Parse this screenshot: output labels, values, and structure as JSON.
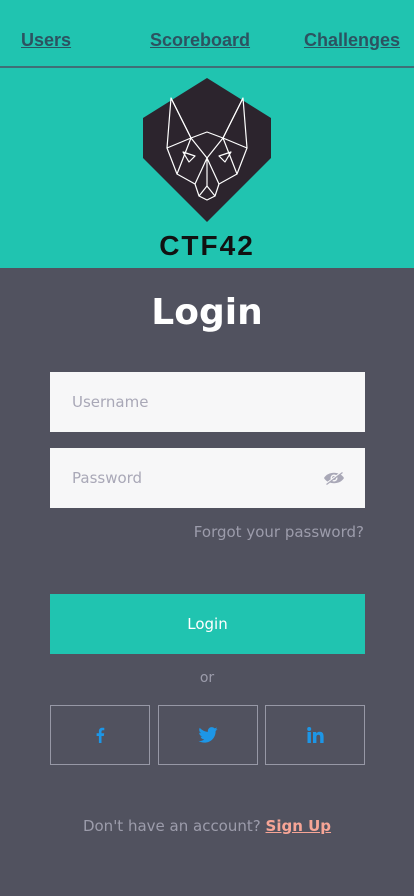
{
  "nav": {
    "users": "Users",
    "scoreboard": "Scoreboard",
    "challenges": "Challenges"
  },
  "brand": {
    "name": "CTF42",
    "logo_icon": "wolf-shield-icon"
  },
  "login": {
    "title": "Login",
    "username_placeholder": "Username",
    "password_placeholder": "Password",
    "password_toggle_icon": "eye-icon",
    "forgot_password": "Forgot your password?",
    "submit_label": "Login",
    "or_label": "or"
  },
  "social": {
    "facebook_icon": "facebook-icon",
    "twitter_icon": "twitter-icon",
    "linkedin_icon": "linkedin-icon"
  },
  "signup": {
    "prompt": "Don't have an account?",
    "link": "Sign Up"
  },
  "colors": {
    "teal": "#20c4b0",
    "background": "#51525f",
    "link_accent": "#f7a596",
    "social_blue": "#1d96e6"
  }
}
